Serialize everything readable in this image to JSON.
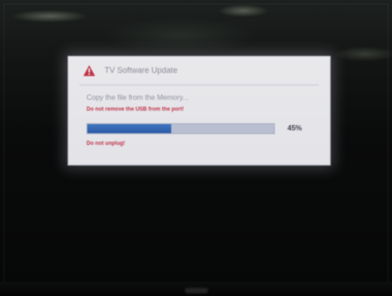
{
  "dialog": {
    "title": "TV Software Update",
    "message": "Copy the file from the Memory...",
    "warning": "Do not remove the USB from the port!",
    "progress_percent": 45,
    "progress_label": "45%",
    "unplug_warning": "Do not unplug!"
  },
  "icons": {
    "warning": "warning-icon"
  },
  "colors": {
    "warning_red": "#c0344a",
    "progress_blue": "#2f63b0",
    "dialog_bg": "#e6e6ea"
  }
}
